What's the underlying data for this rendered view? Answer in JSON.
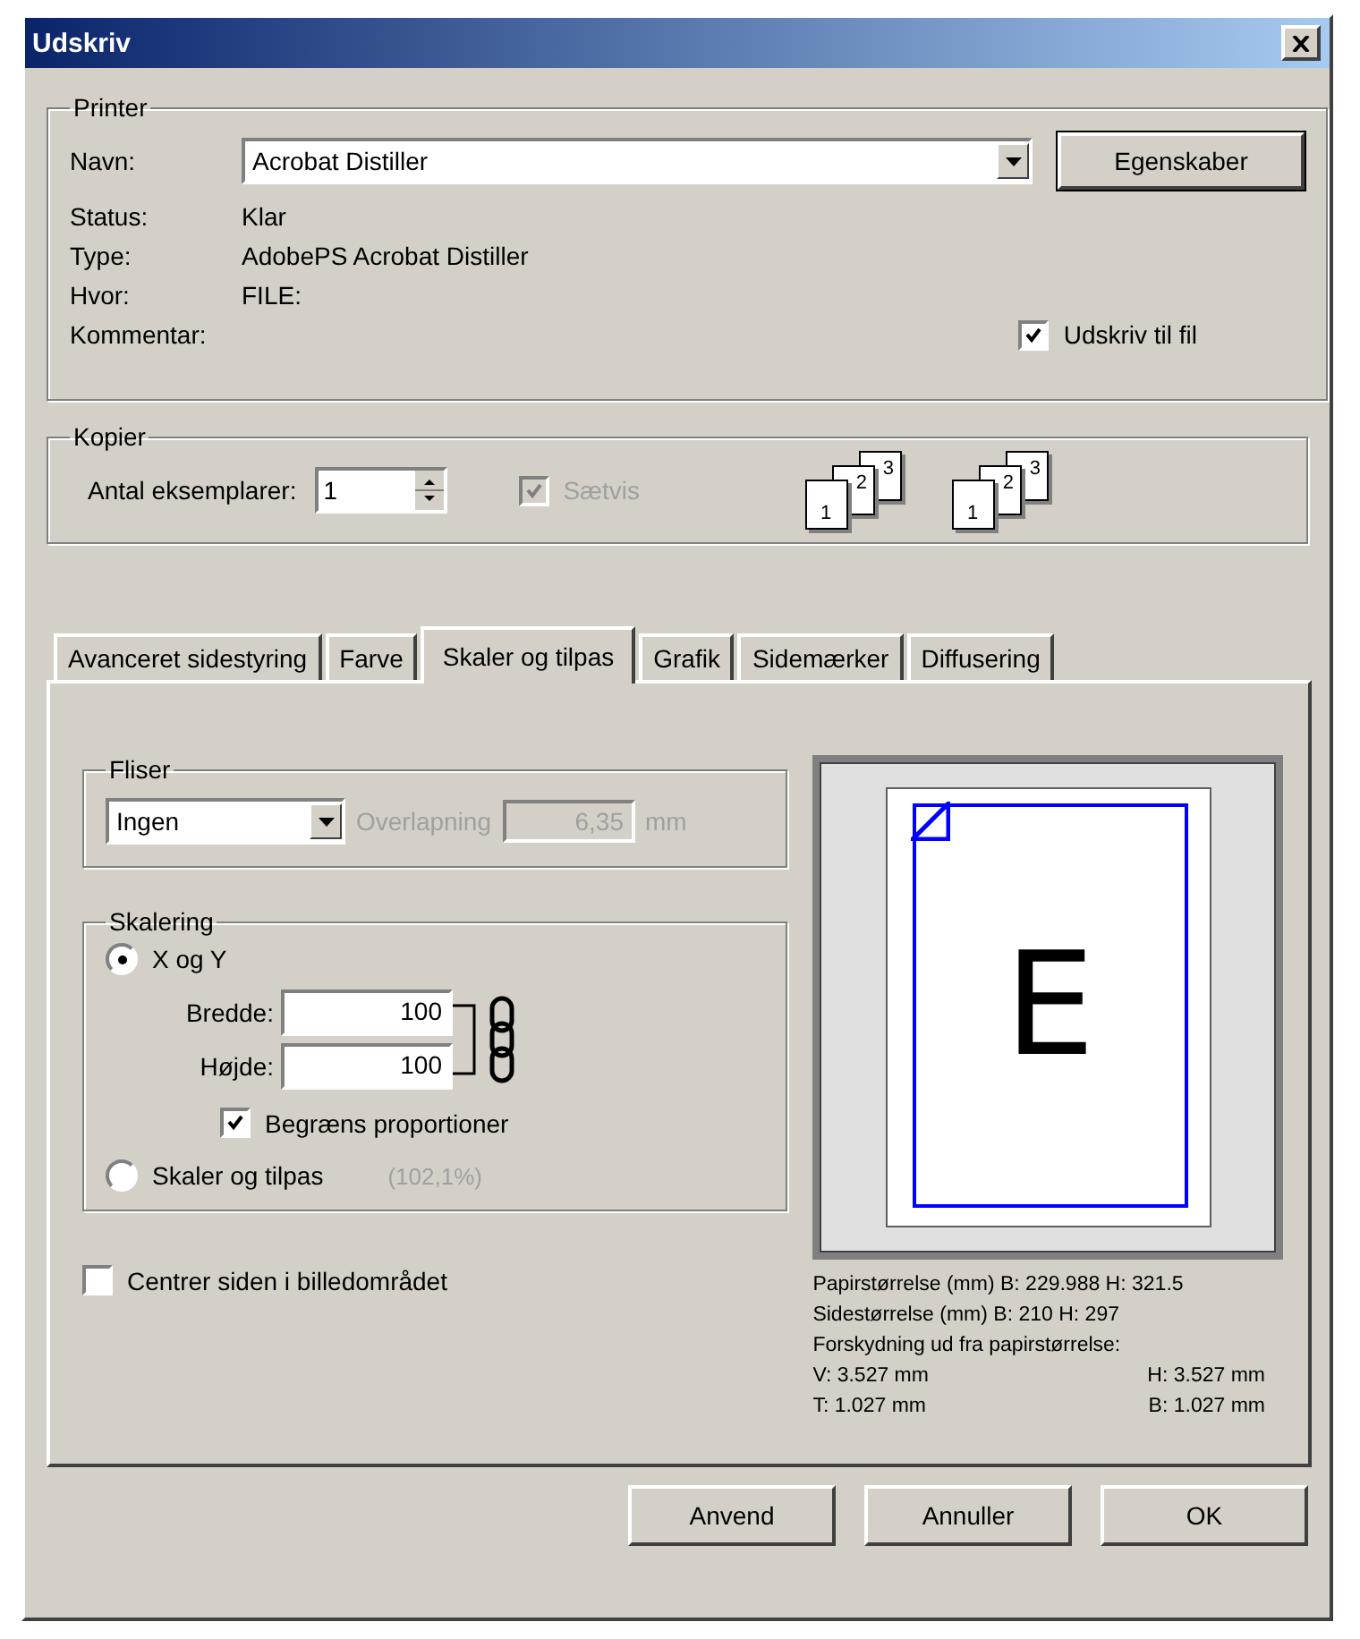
{
  "window": {
    "title": "Udskriv"
  },
  "printer": {
    "legend": "Printer",
    "name_label": "Navn:",
    "name_value": "Acrobat Distiller",
    "properties_button": "Egenskaber",
    "info": [
      {
        "label": "Status:",
        "value": "Klar"
      },
      {
        "label": "Type:",
        "value": "AdobePS Acrobat Distiller"
      },
      {
        "label": "Hvor:",
        "value": "FILE:"
      }
    ],
    "comment_label": "Kommentar:",
    "print_to_file": {
      "label": "Udskriv til fil",
      "checked": true
    }
  },
  "copies": {
    "legend": "Kopier",
    "count_label": "Antal eksemplarer:",
    "count_value": "1",
    "collate": {
      "label": "Sætvis",
      "checked": true,
      "disabled": true
    },
    "collate_icons": [
      {
        "pages": [
          "1",
          "2",
          "3"
        ]
      },
      {
        "pages": [
          "1",
          "2",
          "3"
        ]
      }
    ]
  },
  "tabs": [
    {
      "label": "Avanceret sidestyring",
      "selected": false
    },
    {
      "label": "Farve",
      "selected": false
    },
    {
      "label": "Skaler og tilpas",
      "selected": true
    },
    {
      "label": "Grafik",
      "selected": false
    },
    {
      "label": "Sidemærker",
      "selected": false
    },
    {
      "label": "Diffusering",
      "selected": false
    }
  ],
  "tiles": {
    "legend": "Fliser",
    "select_value": "Ingen",
    "overlap_label": "Overlapning",
    "overlap_value": "6,35",
    "unit": "mm",
    "disabled": true
  },
  "scaling": {
    "legend": "Skalering",
    "options": [
      {
        "label": "X og Y",
        "selected": true
      },
      {
        "label": "Skaler og tilpas",
        "selected": false
      }
    ],
    "width_label": "Bredde:",
    "width_value": "100",
    "height_label": "Højde:",
    "height_value": "100",
    "constrain": {
      "label": "Begræns proportioner",
      "checked": true
    },
    "percent": "(102,1%)"
  },
  "center": {
    "label": "Centrer siden i billedområdet",
    "checked": false
  },
  "preview": {
    "letter": "E"
  },
  "paper_info": {
    "lines": [
      "Papirstørrelse (mm) B: 229.988 H: 321.5",
      "Sidestørrelse (mm) B: 210 H: 297",
      "Forskydning ud fra papirstørrelse:"
    ],
    "offsets": [
      {
        "left": "V: 3.527 mm",
        "right": "H: 3.527 mm"
      },
      {
        "left": "T: 1.027 mm",
        "right": "B: 1.027 mm"
      }
    ]
  },
  "buttons": [
    "Anvend",
    "Annuller",
    "OK"
  ]
}
